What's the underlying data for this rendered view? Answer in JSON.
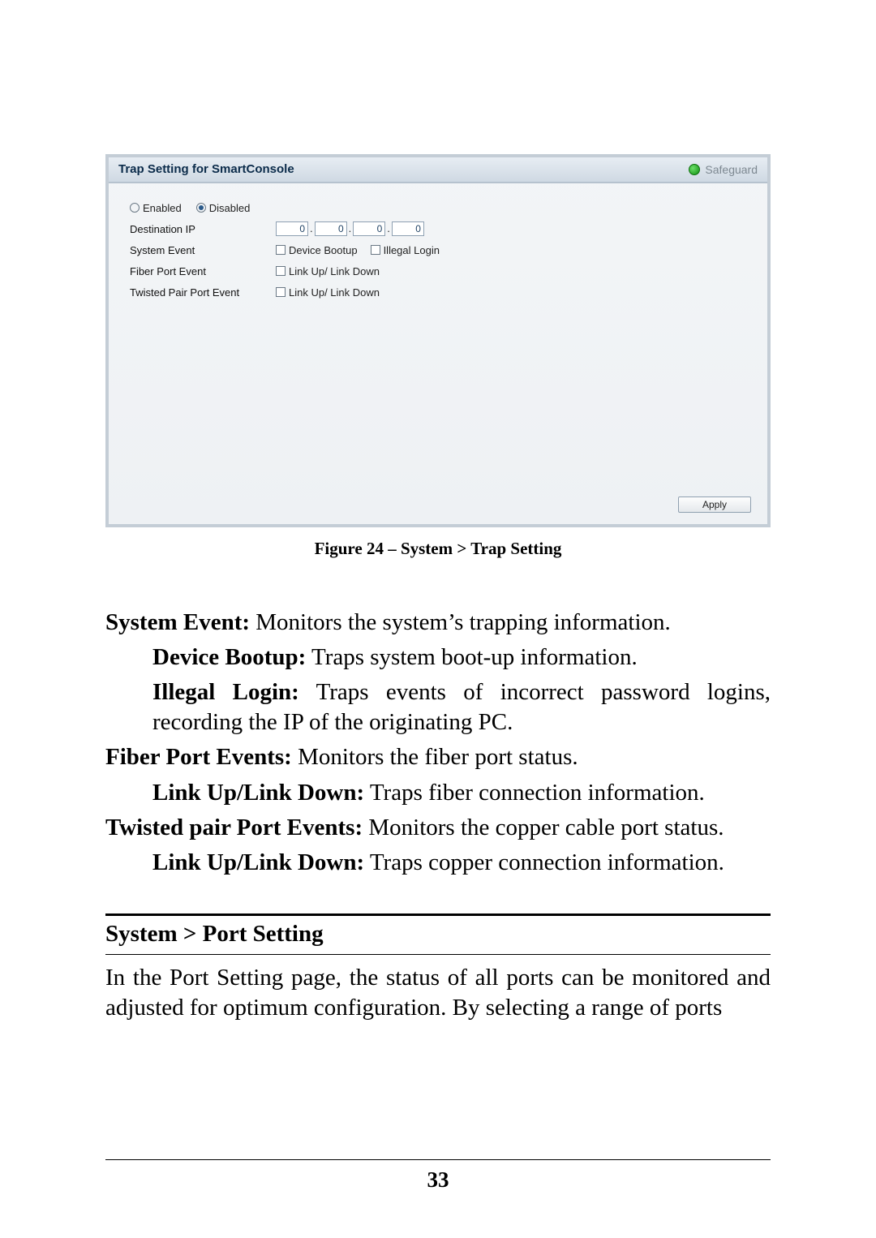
{
  "shot": {
    "title": "Trap Setting for SmartConsole",
    "safeguard": "Safeguard",
    "enabled_label": "Enabled",
    "disabled_label": "Disabled",
    "dest_ip_label": "Destination IP",
    "ip": {
      "a": "0",
      "b": "0",
      "c": "0",
      "d": "0"
    },
    "sys_event_label": "System Event",
    "device_bootup": "Device Bootup",
    "illegal_login": "Illegal Login",
    "fiber_label": "Fiber Port Event",
    "linkupdown": "Link Up/ Link Down",
    "twisted_label": "Twisted Pair Port Event",
    "apply": "Apply"
  },
  "caption": "Figure 24 – System > Trap Setting",
  "text": {
    "sys_event_b": "System Event:",
    "sys_event_r": " Monitors the system’s trapping information.",
    "dev_boot_b": "Device Bootup:",
    "dev_boot_r": " Traps system boot-up information.",
    "ill_login_b": "Illegal Login:",
    "ill_login_r": " Traps events of incorrect password logins, recording the IP of the originating PC.",
    "fiber_b": "Fiber Port Events:",
    "fiber_r": " Monitors the fiber port status.",
    "fiber_link_b": "Link Up/Link Down:",
    "fiber_link_r": " Traps fiber connection information.",
    "tw_b": "Twisted pair Port Events:",
    "tw_r": " Monitors the copper cable port status.",
    "tw_link_b": "Link Up/Link Down:",
    "tw_link_r": " Traps copper connection information."
  },
  "section": {
    "heading": "System > Port Setting",
    "body": "In the Port Setting page, the status of all ports can be monitored and adjusted for optimum configuration. By selecting a range of ports"
  },
  "page_number": "33"
}
